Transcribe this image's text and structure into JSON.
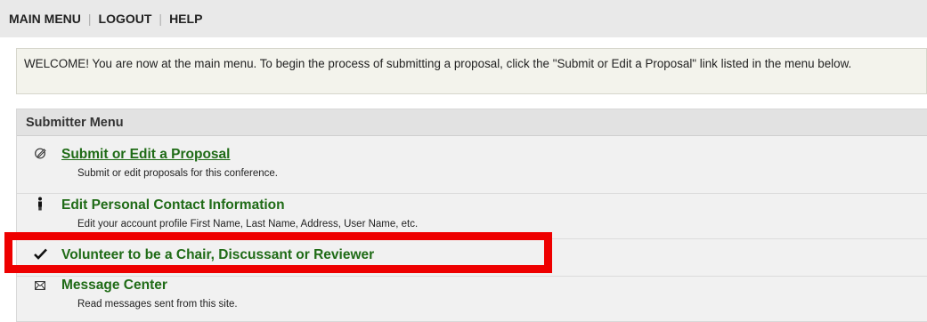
{
  "topnav": {
    "items": [
      "MAIN MENU",
      "LOGOUT",
      "HELP"
    ],
    "separator": "|"
  },
  "welcome": {
    "text": "WELCOME! You are now at the main menu. To begin the process of submitting a proposal, click the \"Submit or Edit a Proposal\" link listed in the menu below."
  },
  "menu": {
    "header": "Submitter Menu",
    "items": [
      {
        "icon": "pencil-icon",
        "title": "Submit or Edit a Proposal",
        "description": "Submit or edit proposals for this conference."
      },
      {
        "icon": "person-icon",
        "title": "Edit Personal Contact Information",
        "description": "Edit your account profile First Name, Last Name, Address, User Name, etc."
      },
      {
        "icon": "checkmark-icon",
        "title": "Volunteer to be a Chair, Discussant or Reviewer",
        "description": ""
      },
      {
        "icon": "envelope-icon",
        "title": "Message Center",
        "description": "Read messages sent from this site."
      }
    ]
  },
  "colors": {
    "link_green": "#1f6b16",
    "highlight_red": "#ee0000",
    "nav_bg": "#e9e9e9"
  }
}
